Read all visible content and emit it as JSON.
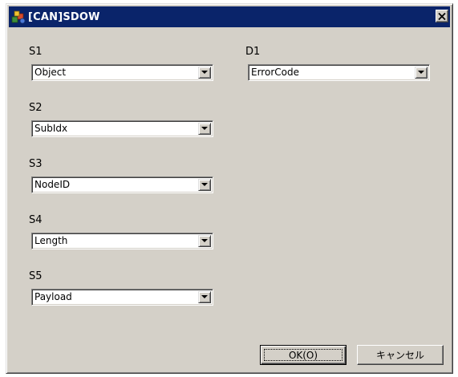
{
  "window": {
    "title": "[CAN]SDOW"
  },
  "icons": {
    "app": "app-icon",
    "close": "close-icon",
    "dropdown": "chevron-down-icon"
  },
  "colors": {
    "titlebar": "#0a246a",
    "face": "#d4d0c8"
  },
  "fields": {
    "s1": {
      "label": "S1",
      "value": "Object"
    },
    "s2": {
      "label": "S2",
      "value": "SubIdx"
    },
    "s3": {
      "label": "S3",
      "value": "NodeID"
    },
    "s4": {
      "label": "S4",
      "value": "Length"
    },
    "s5": {
      "label": "S5",
      "value": "Payload"
    },
    "d1": {
      "label": "D1",
      "value": "ErrorCode"
    }
  },
  "buttons": {
    "ok": "OK(O)",
    "cancel": "キャンセル"
  }
}
